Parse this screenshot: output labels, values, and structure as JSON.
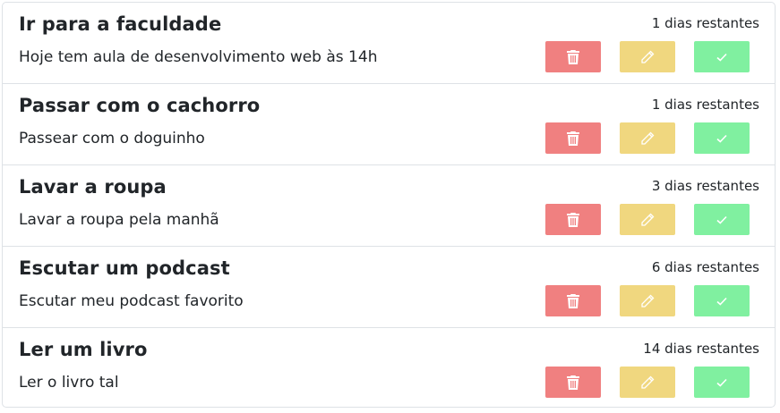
{
  "tasks": [
    {
      "title": "Ir para a faculdade",
      "description": "Hoje tem aula de desenvolvimento web às 14h",
      "days_remaining": "1 dias restantes"
    },
    {
      "title": "Passar com o cachorro",
      "description": "Passear com o doguinho",
      "days_remaining": "1 dias restantes"
    },
    {
      "title": "Lavar a roupa",
      "description": "Lavar a roupa pela manhã",
      "days_remaining": "3 dias restantes"
    },
    {
      "title": "Escutar um podcast",
      "description": "Escutar meu podcast favorito",
      "days_remaining": "6 dias restantes"
    },
    {
      "title": "Ler um livro",
      "description": "Ler o livro tal",
      "days_remaining": "14 dias restantes"
    }
  ],
  "buttons": {
    "delete_icon": "trash-icon",
    "edit_icon": "pencil-icon",
    "done_icon": "check-icon"
  },
  "colors": {
    "delete": "#f08080",
    "edit": "#f0d77f",
    "done": "#80f0a0"
  }
}
